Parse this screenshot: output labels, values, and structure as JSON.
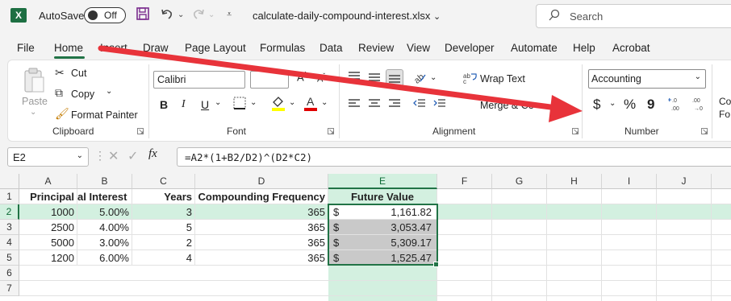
{
  "titlebar": {
    "app_icon": "X",
    "autosave_label": "AutoSave",
    "autosave_state": "Off",
    "filename": "calculate-daily-compound-interest.xlsx",
    "search_placeholder": "Search"
  },
  "menu": {
    "items": [
      "File",
      "Home",
      "Insert",
      "Draw",
      "Page Layout",
      "Formulas",
      "Data",
      "Review",
      "View",
      "Developer",
      "Automate",
      "Help",
      "Acrobat"
    ],
    "active": "Home"
  },
  "ribbon": {
    "clipboard": {
      "paste": "Paste",
      "cut": "Cut",
      "copy": "Copy",
      "format_painter": "Format Painter",
      "label": "Clipboard"
    },
    "font": {
      "font_name": "Calibri",
      "bold": "B",
      "italic": "I",
      "underline": "U",
      "label": "Font"
    },
    "alignment": {
      "wrap_text": "Wrap Text",
      "merge": "Merge & Ce",
      "label": "Alignment"
    },
    "number": {
      "format": "Accounting",
      "currency": "$",
      "percent": "%",
      "comma": "9",
      "label": "Number"
    },
    "cut_off_text": "Co Fo"
  },
  "formula_bar": {
    "cell_ref": "E2",
    "fx": "fx",
    "formula": "=A2*(1+B2/D2)^(D2*C2)"
  },
  "grid": {
    "columns": [
      "A",
      "B",
      "C",
      "D",
      "E",
      "F",
      "G",
      "H",
      "I",
      "J"
    ],
    "rows": [
      "1",
      "2",
      "3",
      "4",
      "5",
      "6",
      "7"
    ],
    "headers": [
      "Principal",
      "al Interest",
      "Years",
      "Compounding Frequency",
      "Future Value"
    ],
    "data": [
      {
        "principal": "1000",
        "rate": "5.00%",
        "years": "3",
        "freq": "365",
        "fv_sym": "$",
        "fv": "1,161.82"
      },
      {
        "principal": "2500",
        "rate": "4.00%",
        "years": "5",
        "freq": "365",
        "fv_sym": "$",
        "fv": "3,053.47"
      },
      {
        "principal": "5000",
        "rate": "3.00%",
        "years": "2",
        "freq": "365",
        "fv_sym": "$",
        "fv": "5,309.17"
      },
      {
        "principal": "1200",
        "rate": "6.00%",
        "years": "4",
        "freq": "365",
        "fv_sym": "$",
        "fv": "1,525.47"
      }
    ],
    "selected_cell": "E2"
  },
  "colors": {
    "excel_green": "#217346",
    "selection_fill": "#d3f0e0",
    "arrow_red": "#e8333a"
  }
}
